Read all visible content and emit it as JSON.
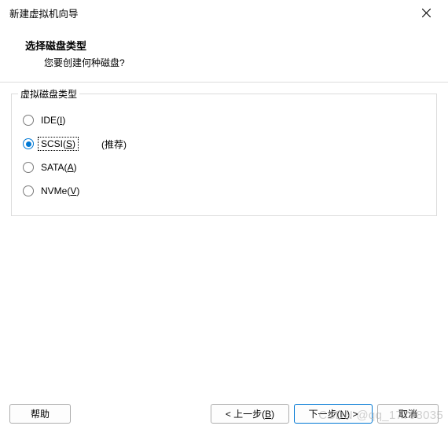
{
  "window": {
    "title": "新建虚拟机向导"
  },
  "header": {
    "title": "选择磁盘类型",
    "subtitle": "您要创建何种磁盘?"
  },
  "group": {
    "label": "虚拟磁盘类型",
    "options": [
      {
        "label_pre": "IDE(",
        "mnemonic": "I",
        "label_post": ")",
        "selected": false,
        "hint": ""
      },
      {
        "label_pre": "SCSI(",
        "mnemonic": "S",
        "label_post": ")",
        "selected": true,
        "hint": "(推荐)"
      },
      {
        "label_pre": "SATA(",
        "mnemonic": "A",
        "label_post": ")",
        "selected": false,
        "hint": ""
      },
      {
        "label_pre": "NVMe(",
        "mnemonic": "V",
        "label_post": ")",
        "selected": false,
        "hint": ""
      }
    ]
  },
  "buttons": {
    "help": "帮助",
    "back_pre": "< 上一步(",
    "back_mn": "B",
    "back_post": ")",
    "next_pre": "下一步(",
    "next_mn": "N",
    "next_post": ") >",
    "cancel": "取消"
  },
  "watermark": "CSDN @qq_17798035"
}
